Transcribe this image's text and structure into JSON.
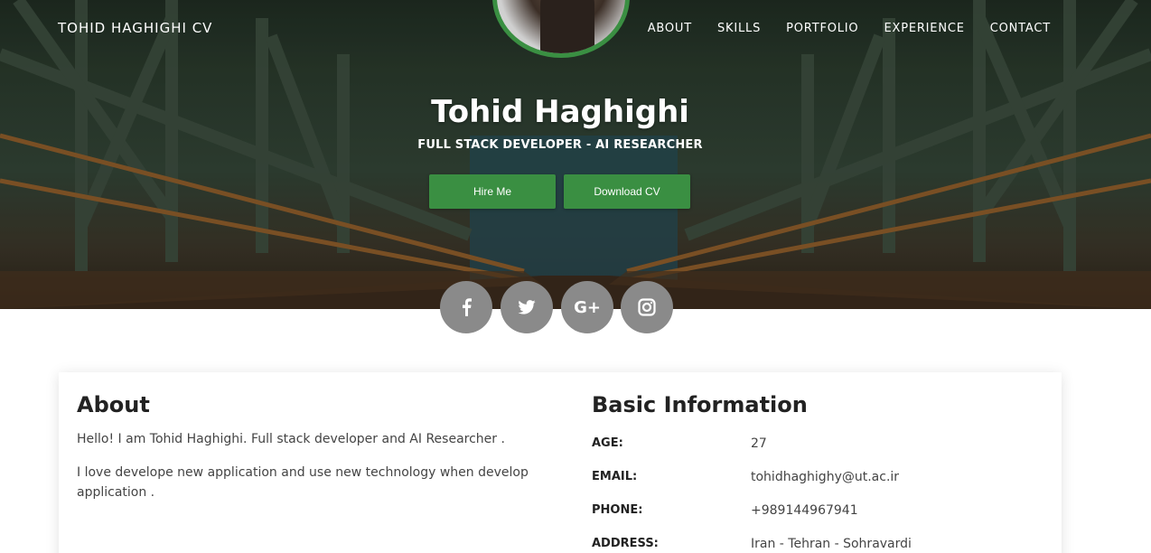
{
  "header": {
    "brand": "TOHID HAGHIGHI CV",
    "nav": [
      "ABOUT",
      "SKILLS",
      "PORTFOLIO",
      "EXPERIENCE",
      "CONTACT"
    ]
  },
  "hero": {
    "name": "Tohid Haghighi",
    "subtitle": "FULL STACK DEVELOPER - AI RESEARCHER",
    "hire_label": "Hire Me",
    "download_label": "Download CV",
    "accent": "#3a8f42"
  },
  "social": [
    {
      "icon": "facebook-icon",
      "glyph": "f"
    },
    {
      "icon": "twitter-icon",
      "glyph": "t"
    },
    {
      "icon": "google-plus-icon",
      "glyph": "G+"
    },
    {
      "icon": "instagram-icon",
      "glyph": ""
    }
  ],
  "about": {
    "title": "About",
    "p1": "Hello! I am Tohid Haghighi. Full stack developer and AI Researcher .",
    "p2": "I love develope new application and use new technology when develop application ."
  },
  "basic": {
    "title": "Basic Information",
    "rows": [
      {
        "label": "AGE:",
        "value": "27"
      },
      {
        "label": "EMAIL:",
        "value": "tohidhaghighy@ut.ac.ir"
      },
      {
        "label": "PHONE:",
        "value": "+989144967941"
      },
      {
        "label": "ADDRESS:",
        "value": "Iran - Tehran - Sohravardi"
      }
    ]
  }
}
